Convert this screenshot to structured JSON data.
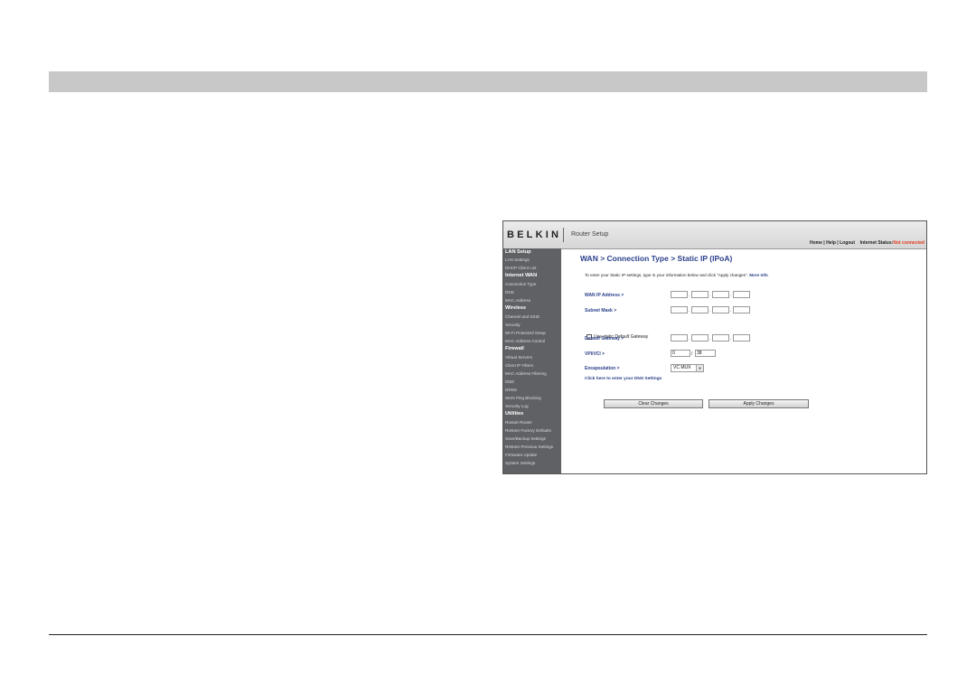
{
  "router": {
    "logo": "BELKIN",
    "app_title": "Router Setup",
    "top_links": [
      "Home",
      "Help",
      "Logout"
    ],
    "status_label": "Internet Status:",
    "status_value": "Not connected",
    "colors": {
      "accent": "#2a3f8a",
      "status": "#e23a1f",
      "sidebar": "#5f6165"
    }
  },
  "sidebar": {
    "sections": [
      {
        "heading": "LAN Setup",
        "items": [
          "LAN Settings",
          "DHCP Client List"
        ]
      },
      {
        "heading": "Internet WAN",
        "items": [
          "Connection Type",
          "DNS",
          "MAC Address"
        ]
      },
      {
        "heading": "Wireless",
        "items": [
          "Channel and SSID",
          "Security",
          "Wi-Fi Protected Setup",
          "MAC Address Control"
        ]
      },
      {
        "heading": "Firewall",
        "items": [
          "Virtual Servers",
          "Client IP Filters",
          "MAC Address Filtering",
          "DMZ",
          "DDNS",
          "WAN Ping Blocking",
          "Security Log"
        ]
      },
      {
        "heading": "Utilities",
        "items": [
          "Restart Router",
          "Restore Factory Defaults",
          "Save/Backup Settings",
          "Restore Previous Settings",
          "Firmware Update",
          "System Settings"
        ]
      }
    ]
  },
  "main": {
    "title": "WAN > Connection Type > Static IP (IPoA)",
    "intro": "To enter your Static IP settings, type in your information below and click \"Apply changes\".",
    "more_info": "More Info",
    "wan_ip_label": "WAN IP Address >",
    "subnet_label": "Subnet Mask >",
    "static_gw_checkbox_label": "Use static Default Gateway",
    "gateway_label": "Default Gateway >",
    "vpi_vci_label": "VPI/VCI >",
    "vpi_value": "0",
    "vci_value": "38",
    "encapsulation_label": "Encapsulation >",
    "encapsulation_value": "VC MUX",
    "dns_link": "Click here to enter your DNS Settings",
    "clear_button": "Clear Changes",
    "apply_button": "Apply Changes"
  }
}
